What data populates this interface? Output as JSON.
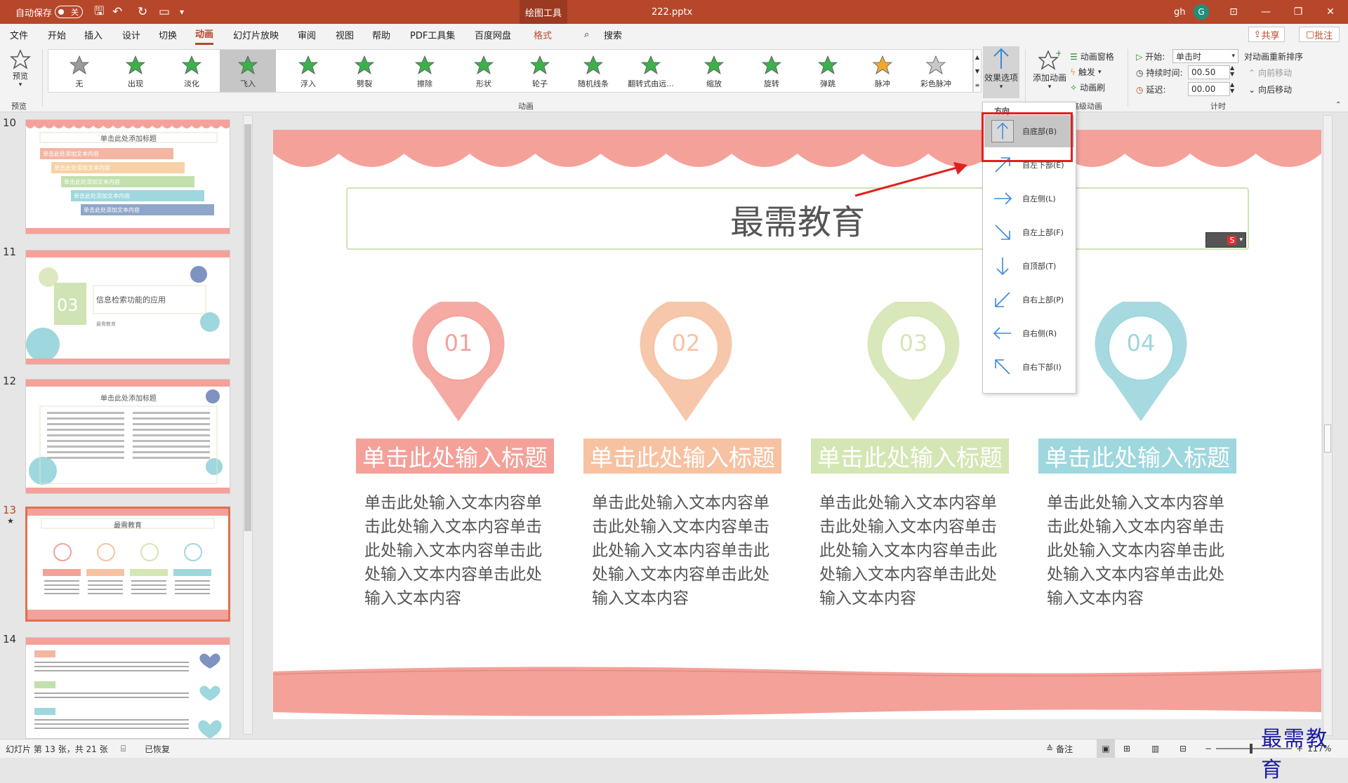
{
  "titlebar": {
    "autosave_label": "自动保存",
    "autosave_state": "关",
    "context_tab": "绘图工具",
    "doc_title": "222.pptx",
    "user": "gh",
    "avatar_letter": "G"
  },
  "menu": {
    "items": [
      "文件",
      "开始",
      "插入",
      "设计",
      "切换",
      "动画",
      "幻灯片放映",
      "审阅",
      "视图",
      "帮助",
      "PDF工具集",
      "百度网盘",
      "格式"
    ],
    "search": "搜索",
    "share": "共享",
    "comment": "批注"
  },
  "ribbon": {
    "preview_label": "预览",
    "preview_group": "预览",
    "animation_group": "动画",
    "advanced_group": "高级动画",
    "timing_group": "计时",
    "animations": [
      "无",
      "出现",
      "淡化",
      "飞入",
      "浮入",
      "劈裂",
      "擦除",
      "形状",
      "轮子",
      "随机线条",
      "翻转式由远...",
      "缩放",
      "旋转",
      "弹跳",
      "脉冲",
      "彩色脉冲"
    ],
    "effect_options": "效果选项",
    "add_animation": "添加动画",
    "animation_pane": "动画窗格",
    "trigger": "触发",
    "animation_painter": "动画刷",
    "start_label": "开始:",
    "start_value": "单击时",
    "duration_label": "持续时间:",
    "duration_value": "00.50",
    "delay_label": "延迟:",
    "delay_value": "00.00",
    "reorder_label": "对动画重新排序",
    "move_earlier": "向前移动",
    "move_later": "向后移动"
  },
  "direction_menu": {
    "header": "方向",
    "items": [
      "自底部(B)",
      "自左下部(E)",
      "自左侧(L)",
      "自左上部(F)",
      "自顶部(T)",
      "自右上部(P)",
      "自右侧(R)",
      "自右下部(I)"
    ]
  },
  "thumbnails": {
    "numbers": [
      "10",
      "11",
      "12",
      "13",
      "14"
    ],
    "t10_title": "单击此处添加标题",
    "t10_bar": "单击此处添加文本内容",
    "t11_num": "03",
    "t11_text": "信息检索功能的应用",
    "t11_sub": "最需教育",
    "t12_title": "单击此处添加标题",
    "t13_title": "最需教育"
  },
  "slide": {
    "title": "最需教育",
    "nums": [
      "01",
      "02",
      "03",
      "04"
    ],
    "category_title": "单击此处输入标题",
    "body": "单击此处输入文本内容单击此处输入文本内容单击此处输入文本内容单击此处输入文本内容单击此处输入文本内容"
  },
  "statusbar": {
    "slide_info": "幻灯片 第 13 张，共 21 张",
    "recovered": "已恢复",
    "notes": "备注",
    "zoom": "117%"
  },
  "watermark": "最需教育",
  "colors": {
    "accent": "#b7472a",
    "pink": "#f4a19a",
    "peach": "#f7c2a2",
    "green": "#d4e6b4",
    "teal": "#9ed7dd"
  }
}
